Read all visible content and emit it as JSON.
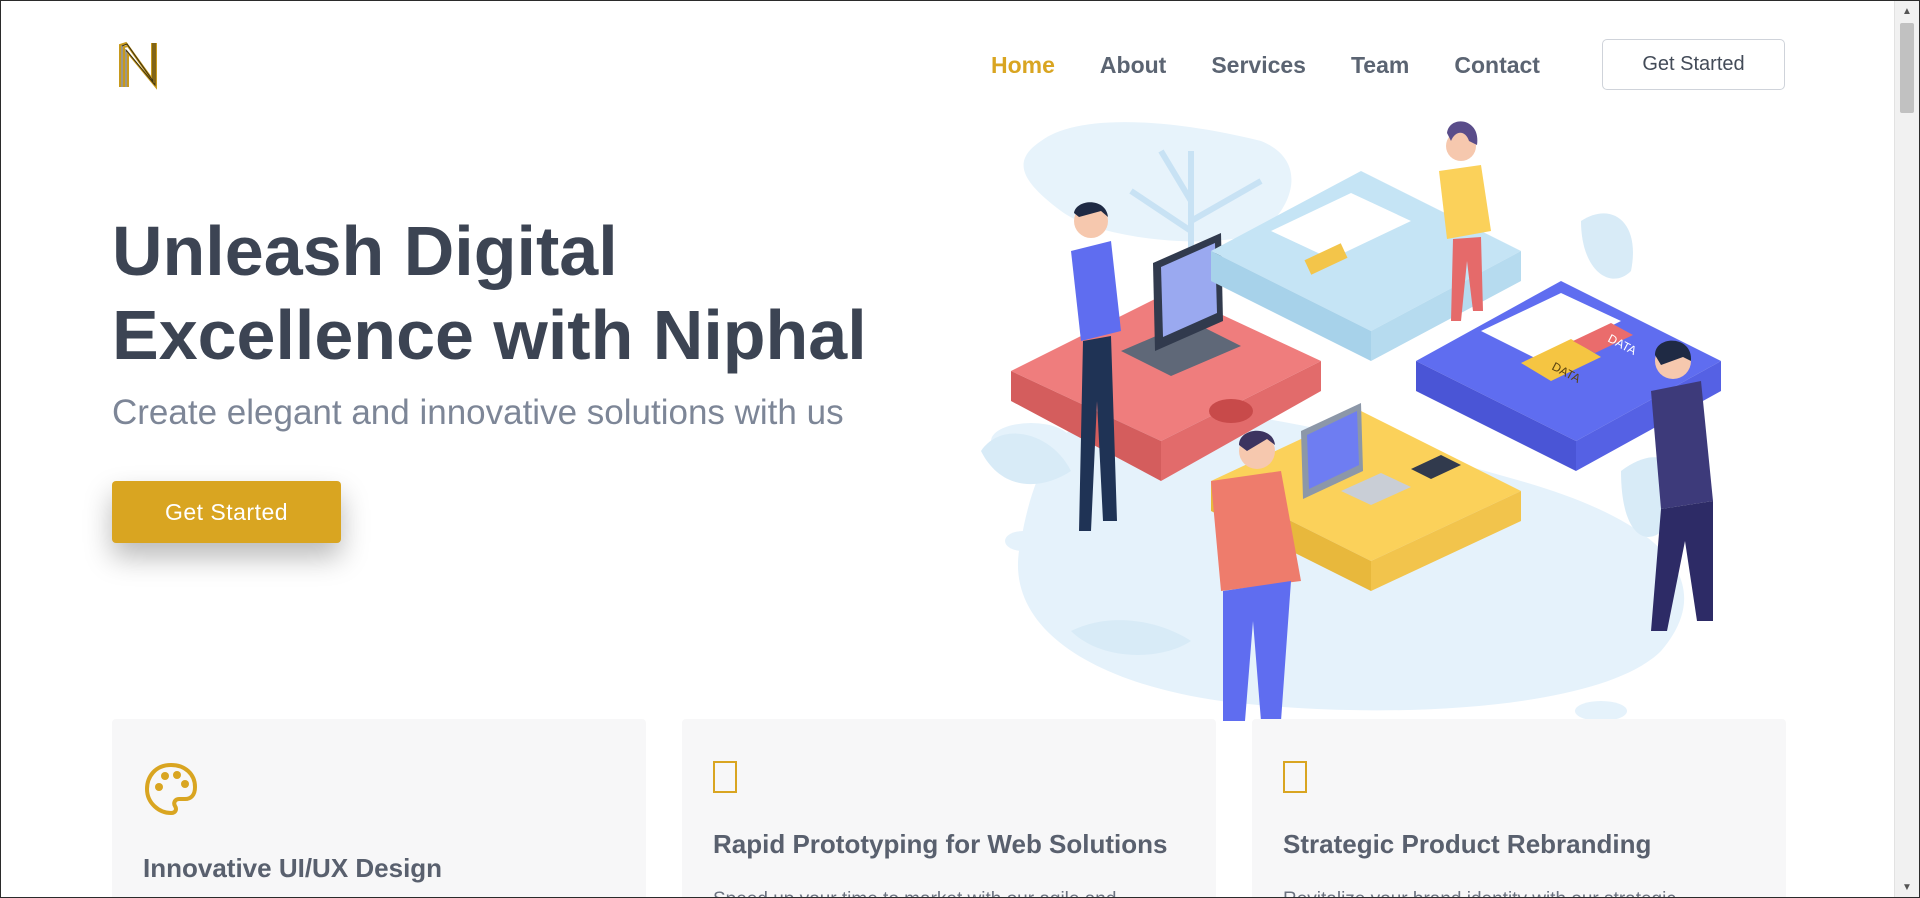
{
  "brand": {
    "logo_letter": "N",
    "accent_color": "#d9a521",
    "heading_color": "#3c4453"
  },
  "nav": {
    "items": [
      {
        "label": "Home",
        "active": true
      },
      {
        "label": "About",
        "active": false
      },
      {
        "label": "Services",
        "active": false
      },
      {
        "label": "Team",
        "active": false
      },
      {
        "label": "Contact",
        "active": false
      }
    ],
    "cta_label": "Get Started"
  },
  "hero": {
    "title_line1": "Unleash Digital",
    "title_line2": "Excellence with Niphal",
    "subtitle": "Create elegant and innovative solutions with us",
    "cta_label": "Get Started",
    "illustration_labels": [
      "DATA",
      "DATA"
    ]
  },
  "features": [
    {
      "icon": "palette-icon",
      "title": "Innovative UI/UX Design",
      "text": ""
    },
    {
      "icon": "missing-glyph-icon",
      "title": "Rapid Prototyping for Web Solutions",
      "text": "Speed up your time to market with our agile and"
    },
    {
      "icon": "missing-glyph-icon",
      "title": "Strategic Product Rebranding",
      "text": "Revitalize your brand identity with our strategic"
    }
  ]
}
